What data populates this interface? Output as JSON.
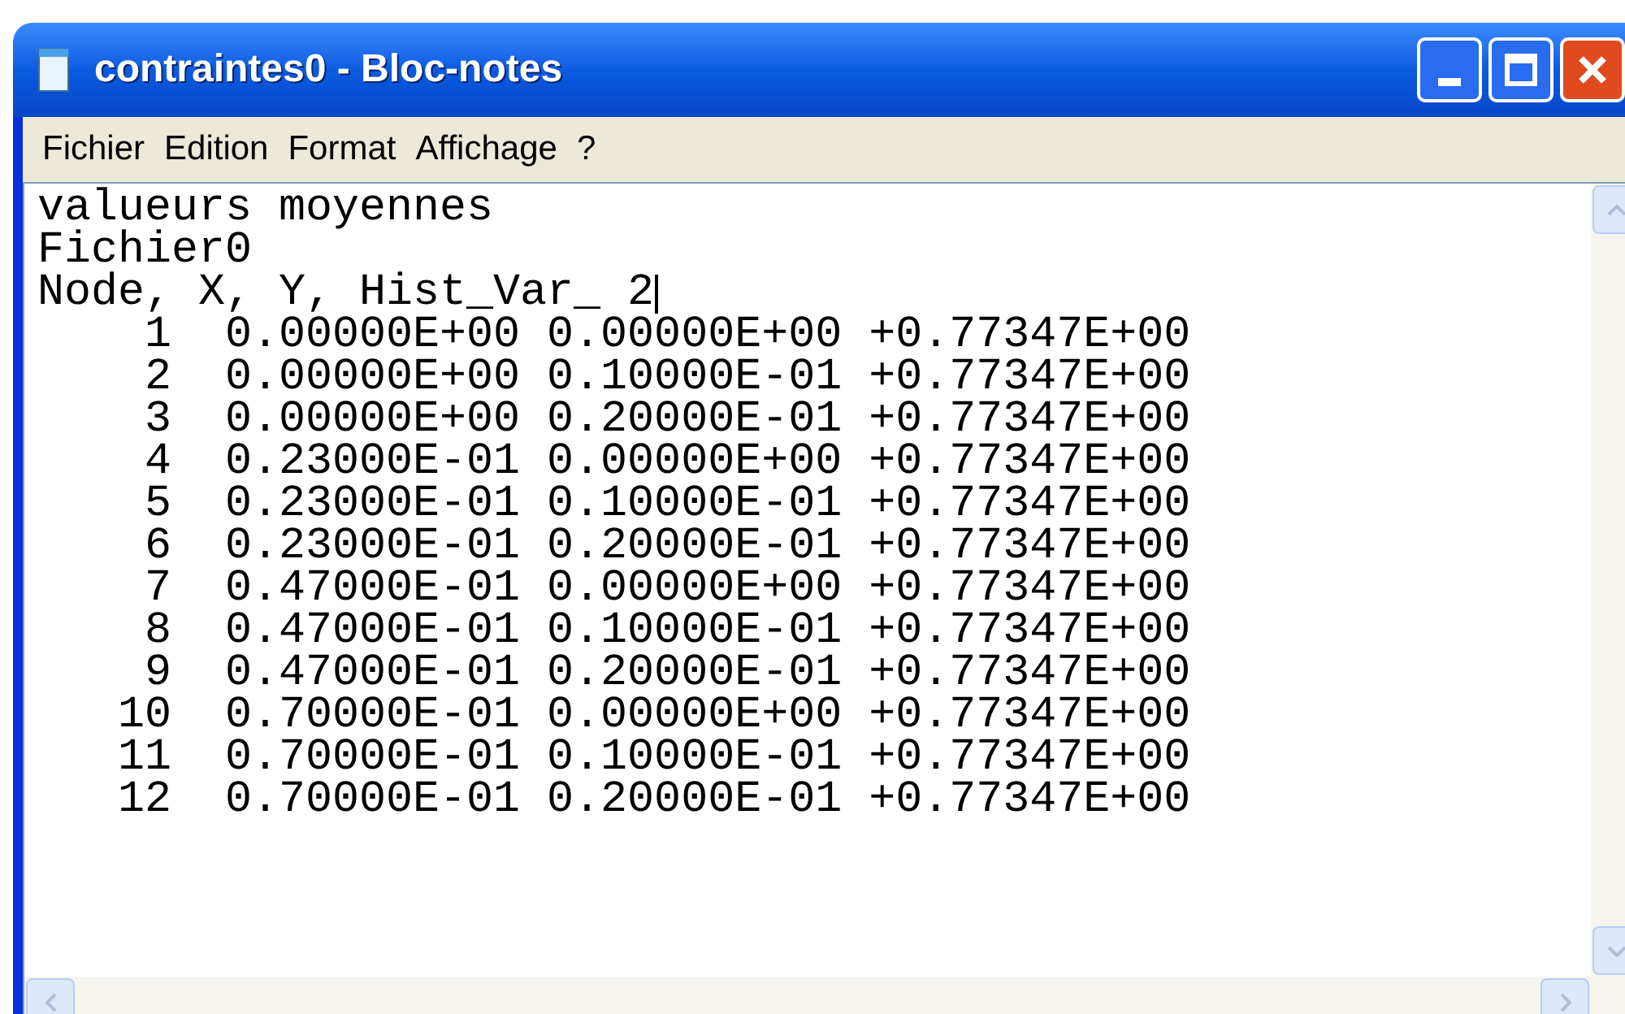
{
  "window": {
    "title": "contraintes0 - Bloc-notes"
  },
  "menu": [
    "Fichier",
    "Edition",
    "Format",
    "Affichage",
    "?"
  ],
  "editor": {
    "lines": [
      {
        "text": "valueurs moyennes",
        "caret": false
      },
      {
        "text": "Fichier0",
        "caret": false
      },
      {
        "text": "Node, X, Y, Hist_Var_ 2",
        "caret": true
      },
      {
        "text": "    1  0.00000E+00 0.00000E+00 +0.77347E+00",
        "caret": false
      },
      {
        "text": "    2  0.00000E+00 0.10000E-01 +0.77347E+00",
        "caret": false
      },
      {
        "text": "    3  0.00000E+00 0.20000E-01 +0.77347E+00",
        "caret": false
      },
      {
        "text": "    4  0.23000E-01 0.00000E+00 +0.77347E+00",
        "caret": false
      },
      {
        "text": "    5  0.23000E-01 0.10000E-01 +0.77347E+00",
        "caret": false
      },
      {
        "text": "    6  0.23000E-01 0.20000E-01 +0.77347E+00",
        "caret": false
      },
      {
        "text": "    7  0.47000E-01 0.00000E+00 +0.77347E+00",
        "caret": false
      },
      {
        "text": "    8  0.47000E-01 0.10000E-01 +0.77347E+00",
        "caret": false
      },
      {
        "text": "    9  0.47000E-01 0.20000E-01 +0.77347E+00",
        "caret": false
      },
      {
        "text": "   10  0.70000E-01 0.00000E+00 +0.77347E+00",
        "caret": false
      },
      {
        "text": "   11  0.70000E-01 0.10000E-01 +0.77347E+00",
        "caret": false
      },
      {
        "text": "   12  0.70000E-01 0.20000E-01 +0.77347E+00",
        "caret": false
      }
    ]
  }
}
